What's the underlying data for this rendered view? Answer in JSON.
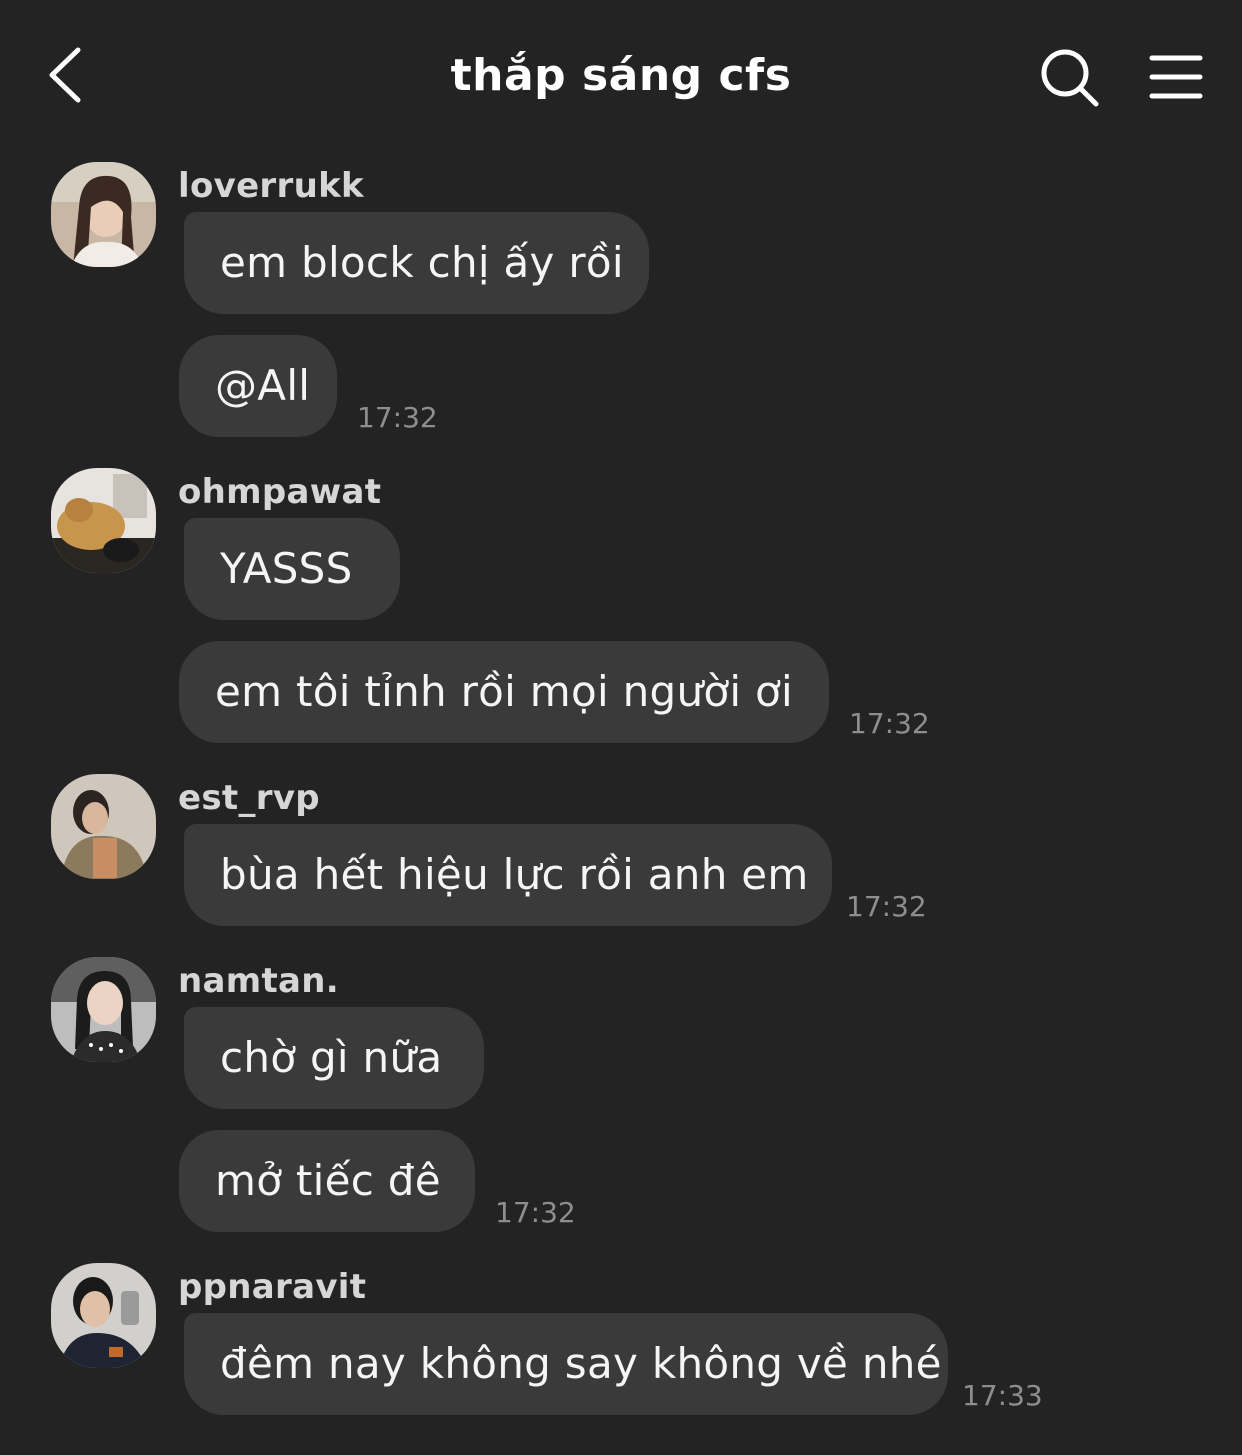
{
  "header": {
    "title": "thắp sáng cfs"
  },
  "icons": {
    "back": "chevron-left-icon",
    "search": "search-icon",
    "menu": "hamburger-menu-icon"
  },
  "colors": {
    "background": "#232324",
    "bubble": "#3a3a3b",
    "text": "#ffffff",
    "timestamp": "#8e8e90"
  },
  "messages": [
    {
      "user": "loverrukk",
      "bubbles": [
        "em block chị ấy rồi",
        "@All"
      ],
      "time": "17:32"
    },
    {
      "user": "ohmpawat",
      "bubbles": [
        "YASSS",
        "em tôi tỉnh rồi mọi người ơi"
      ],
      "time": "17:32"
    },
    {
      "user": "est_rvp",
      "bubbles": [
        "bùa hết hiệu lực rồi anh em"
      ],
      "time": "17:32"
    },
    {
      "user": "namtan.",
      "bubbles": [
        "chờ gì nữa",
        "mở tiếc đê"
      ],
      "time": "17:32"
    },
    {
      "user": "ppnaravit",
      "bubbles": [
        "đêm nay không say không về nhé"
      ],
      "time": "17:33"
    }
  ]
}
